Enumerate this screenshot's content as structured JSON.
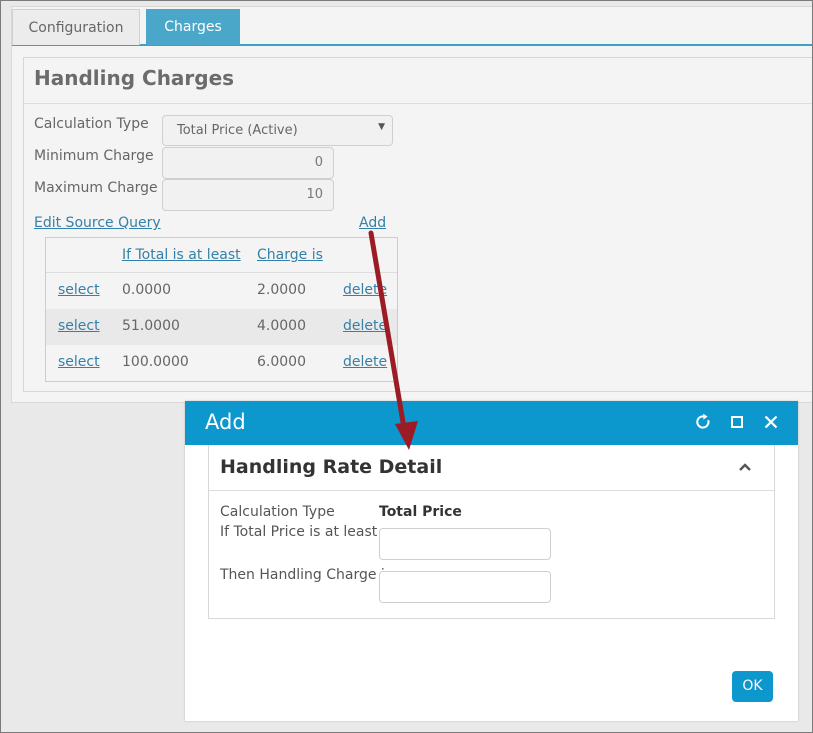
{
  "tabs": [
    {
      "label": "Configuration",
      "active": false
    },
    {
      "label": "Charges",
      "active": true
    }
  ],
  "section": {
    "title": "Handling Charges",
    "calc_type_label": "Calculation Type",
    "calc_type_value": "Total Price (Active)",
    "min_label": "Minimum Charge",
    "min_value": "0",
    "max_label": "Maximum Charge",
    "max_value": "10",
    "edit_query_link": "Edit Source Query",
    "add_link": "Add"
  },
  "grid": {
    "headers": [
      "If Total is at least",
      "Charge is"
    ],
    "rows": [
      {
        "select": "select",
        "min": "0.0000",
        "charge": "2.0000",
        "delete": "delete"
      },
      {
        "select": "select",
        "min": "51.0000",
        "charge": "4.0000",
        "delete": "delete"
      },
      {
        "select": "select",
        "min": "100.0000",
        "charge": "6.0000",
        "delete": "delete"
      }
    ]
  },
  "dialog": {
    "title": "Add",
    "panel_title": "Handling Rate Detail",
    "calc_type_label": "Calculation Type",
    "calc_type_value": "Total Price",
    "total_label": "If Total Price is at least",
    "total_value": "",
    "charge_label": "Then Handling Charge is",
    "charge_value": "",
    "ok_label": "OK",
    "icons": [
      "refresh-icon",
      "maximize-icon",
      "close-icon",
      "chevron-up-icon"
    ]
  },
  "colors": {
    "accent": "#0c97cd",
    "tab_active": "#4aa7c9",
    "link": "#3580a8",
    "arrow": "#9b1c24"
  }
}
